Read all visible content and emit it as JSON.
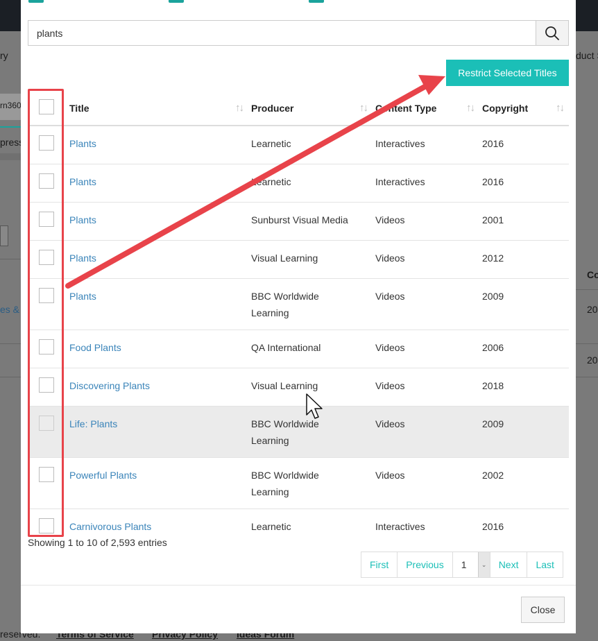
{
  "background": {
    "nav_fragment_left": "ry",
    "nav_fragment_right": "duct S",
    "tab_fragment": "rn360",
    "label_fragment": "press",
    "col_fragment": "Co",
    "link_fragment": "es & S",
    "cell_fragment_1": "20",
    "cell_fragment_2": "20",
    "footer_fragment": "reserved.",
    "footer_links": [
      "Terms of Service",
      "Privacy Policy",
      "Ideas Forum"
    ]
  },
  "search": {
    "value": "plants",
    "button_icon": "search-icon"
  },
  "restrict_button": "Restrict Selected Titles",
  "table": {
    "headers": [
      "Title",
      "Producer",
      "Content Type",
      "Copyright"
    ],
    "rows": [
      {
        "title": "Plants",
        "producer": "Learnetic",
        "type": "Interactives",
        "copyright": "2016"
      },
      {
        "title": "Plants",
        "producer": "Learnetic",
        "type": "Interactives",
        "copyright": "2016"
      },
      {
        "title": "Plants",
        "producer": "Sunburst Visual Media",
        "type": "Videos",
        "copyright": "2001"
      },
      {
        "title": "Plants",
        "producer": "Visual Learning",
        "type": "Videos",
        "copyright": "2012"
      },
      {
        "title": "Plants",
        "producer": "BBC Worldwide Learning",
        "type": "Videos",
        "copyright": "2009"
      },
      {
        "title": "Food Plants",
        "producer": "QA International",
        "type": "Videos",
        "copyright": "2006"
      },
      {
        "title": "Discovering Plants",
        "producer": "Visual Learning",
        "type": "Videos",
        "copyright": "2018"
      },
      {
        "title": "Life: Plants",
        "producer": "BBC Worldwide Learning",
        "type": "Videos",
        "copyright": "2009"
      },
      {
        "title": "Powerful Plants",
        "producer": "BBC Worldwide Learning",
        "type": "Videos",
        "copyright": "2002"
      },
      {
        "title": "Carnivorous Plants",
        "producer": "Learnetic",
        "type": "Interactives",
        "copyright": "2016"
      }
    ]
  },
  "showing_text": "Showing 1 to 10 of 2,593 entries",
  "pagination": {
    "first": "First",
    "previous": "Previous",
    "page": "1",
    "next": "Next",
    "last": "Last"
  },
  "close_button": "Close",
  "colors": {
    "accent": "#1bbfb7",
    "link": "#3a84b9",
    "annotation": "#e8434a"
  }
}
